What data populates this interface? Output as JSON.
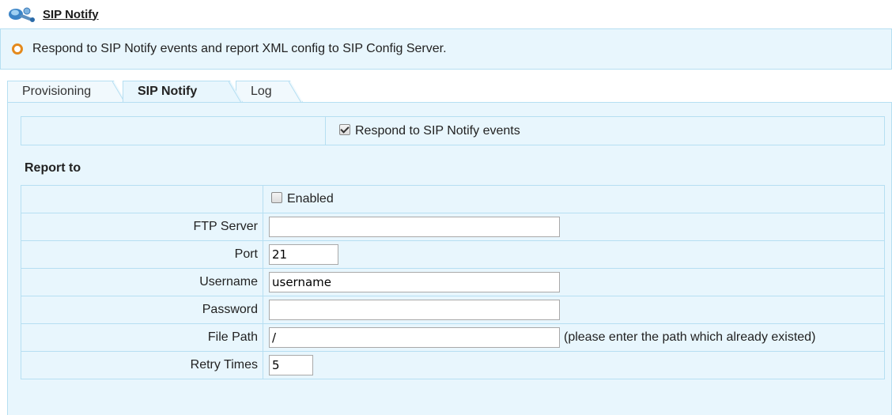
{
  "header": {
    "title": "SIP Notify",
    "icon": "network-settings-icon"
  },
  "info": {
    "text": "Respond to SIP Notify events and report XML config to SIP Config Server.",
    "bullet_color": "#e48a1d"
  },
  "tabs": [
    {
      "label": "Provisioning",
      "active": false
    },
    {
      "label": "SIP Notify",
      "active": true
    },
    {
      "label": "Log",
      "active": false
    }
  ],
  "respond": {
    "label": "Respond to SIP Notify events",
    "checked": true
  },
  "report": {
    "section_title": "Report to",
    "enabled_label": "Enabled",
    "enabled": false,
    "fields": {
      "ftp_server": {
        "label": "FTP Server",
        "value": ""
      },
      "port": {
        "label": "Port",
        "value": "21"
      },
      "username": {
        "label": "Username",
        "value": "username"
      },
      "password": {
        "label": "Password",
        "value": ""
      },
      "file_path": {
        "label": "File Path",
        "value": "/",
        "hint": "(please enter the path which already existed)"
      },
      "retry_times": {
        "label": "Retry Times",
        "value": "5"
      }
    }
  },
  "colors": {
    "panel_bg": "#e8f6fd",
    "border": "#b6dff2",
    "accent": "#e48a1d"
  }
}
